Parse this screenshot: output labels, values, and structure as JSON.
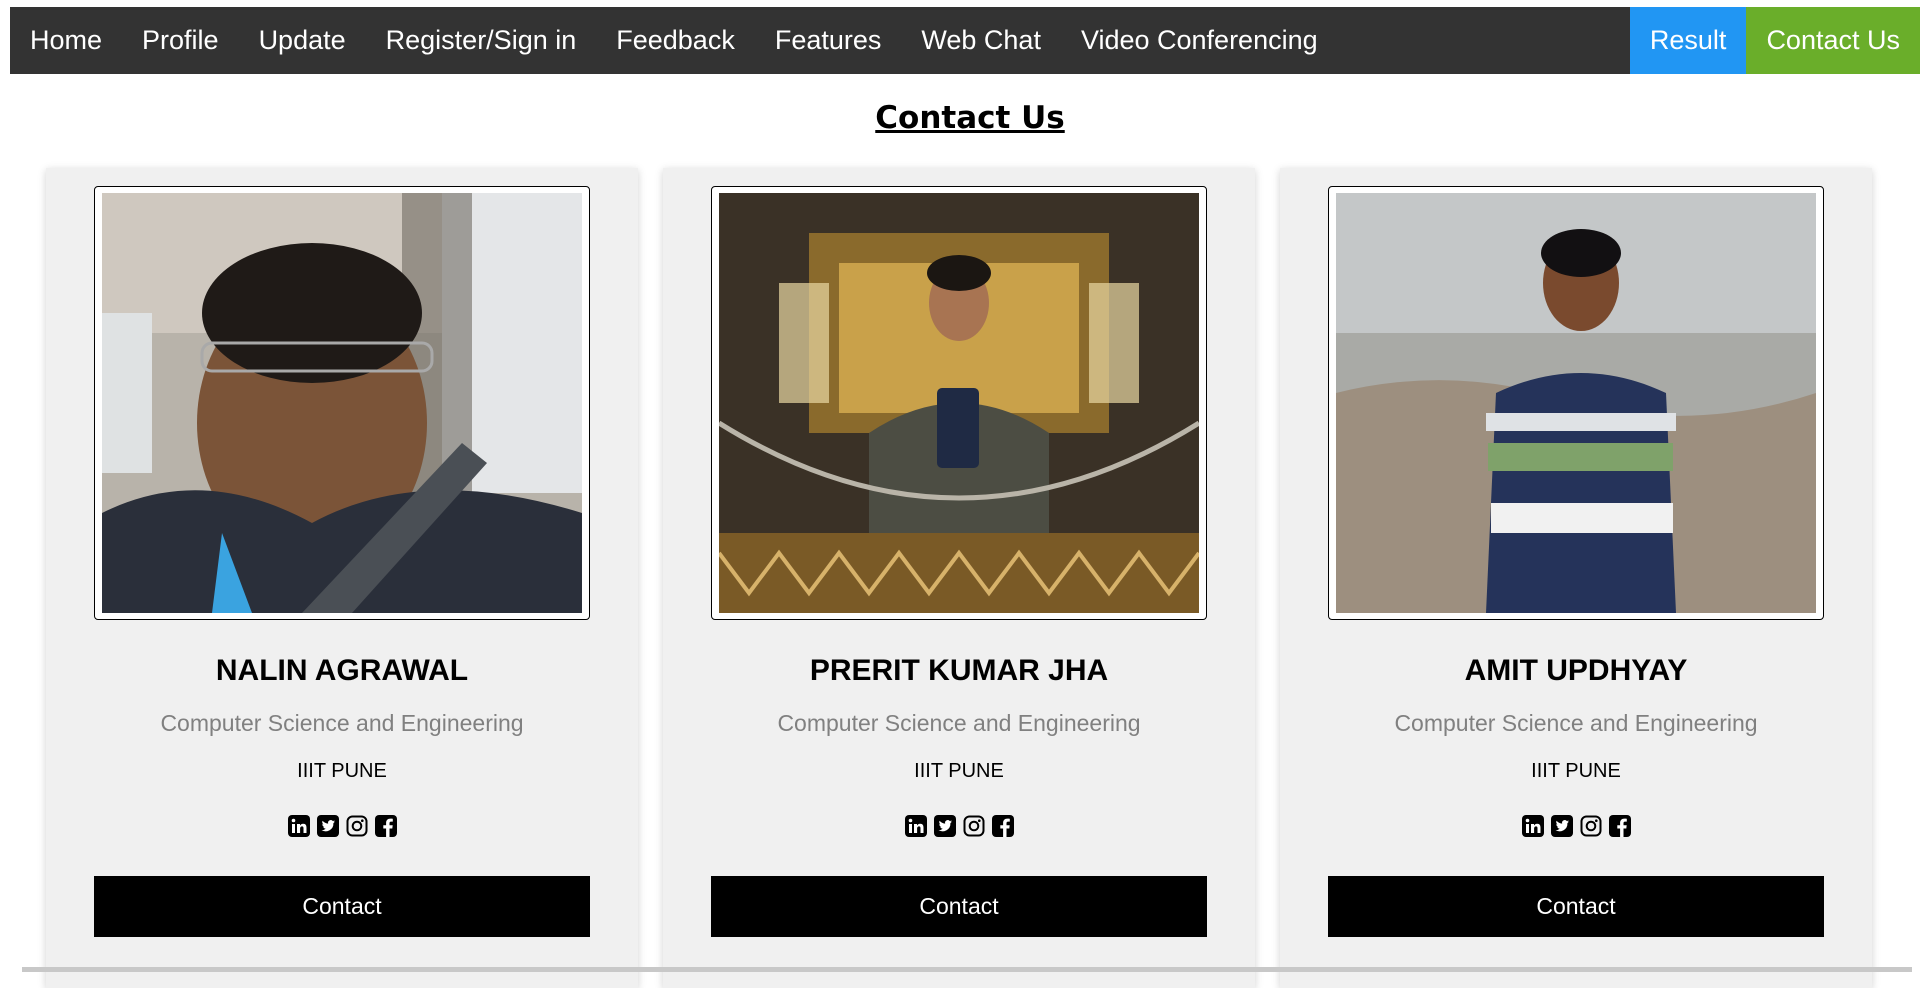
{
  "nav": {
    "items": [
      "Home",
      "Profile",
      "Update",
      "Register/Sign in",
      "Feedback",
      "Features",
      "Web Chat",
      "Video Conferencing"
    ],
    "result_label": "Result",
    "contact_label": "Contact Us",
    "colors": {
      "bar": "#333333",
      "result": "#2196F3",
      "contact": "#6AAE2A"
    }
  },
  "page": {
    "title": "Contact Us"
  },
  "cards": [
    {
      "name": "NALIN AGRAWAL",
      "dept": "Computer Science and Engineering",
      "inst": "IIIT PUNE",
      "button": "Contact"
    },
    {
      "name": "PRERIT KUMAR JHA",
      "dept": "Computer Science and Engineering",
      "inst": "IIIT PUNE",
      "button": "Contact"
    },
    {
      "name": "AMIT UPDHYAY",
      "dept": "Computer Science and Engineering",
      "inst": "IIIT PUNE",
      "button": "Contact"
    }
  ],
  "social_icons": [
    "linkedin-icon",
    "twitter-icon",
    "instagram-icon",
    "facebook-icon"
  ]
}
